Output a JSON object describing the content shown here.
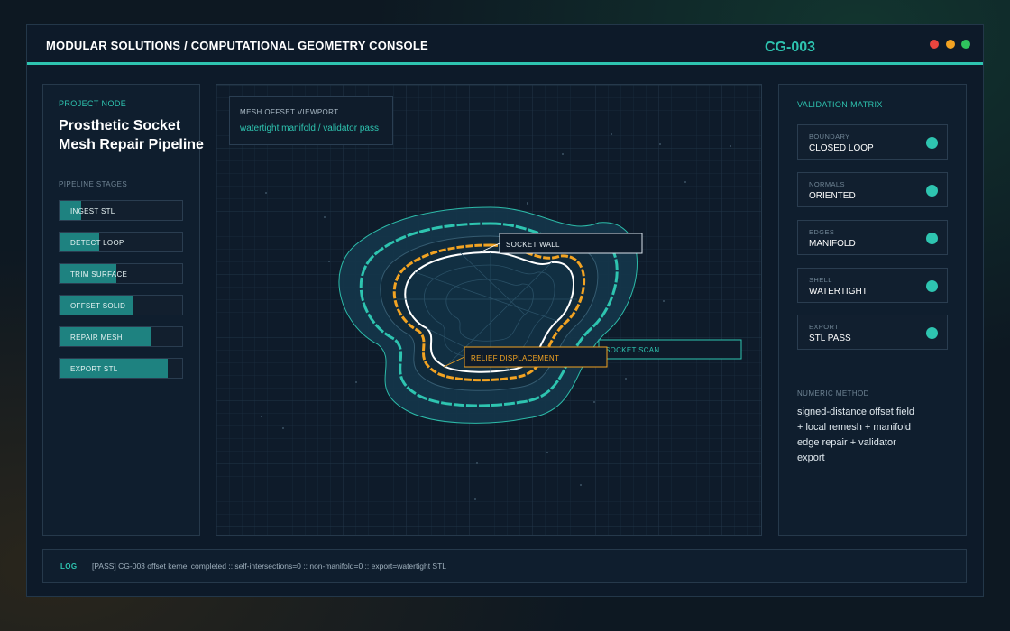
{
  "window": {
    "title": "MODULAR SOLUTIONS / COMPUTATIONAL GEOMETRY CONSOLE",
    "console_id": "CG-003",
    "controls": [
      "close",
      "minimize",
      "maximize"
    ]
  },
  "left_panel": {
    "section_label": "PROJECT NODE",
    "project_title_line1": "Prosthetic Socket",
    "project_title_line2": "Mesh Repair Pipeline",
    "stages_label": "PIPELINE STAGES",
    "stages": [
      {
        "label": "INGEST STL",
        "progress": 0.18
      },
      {
        "label": "DETECT LOOP",
        "progress": 0.32
      },
      {
        "label": "TRIM SURFACE",
        "progress": 0.46
      },
      {
        "label": "OFFSET SOLID",
        "progress": 0.6
      },
      {
        "label": "REPAIR MESH",
        "progress": 0.74
      },
      {
        "label": "EXPORT STL",
        "progress": 0.88
      }
    ]
  },
  "viewport": {
    "title": "MESH OFFSET VIEWPORT",
    "subtitle": "watertight manifold / validator pass",
    "callouts": {
      "socket_wall": "SOCKET WALL",
      "relief_displacement": "RELIEF DISPLACEMENT",
      "socket_scan": "SOCKET SCAN"
    }
  },
  "right_panel": {
    "section_label": "VALIDATION MATRIX",
    "checks": [
      {
        "key": "BOUNDARY",
        "value": "CLOSED LOOP"
      },
      {
        "key": "NORMALS",
        "value": "ORIENTED"
      },
      {
        "key": "EDGES",
        "value": "MANIFOLD"
      },
      {
        "key": "SHELL",
        "value": "WATERTIGHT"
      },
      {
        "key": "EXPORT",
        "value": "STL PASS"
      }
    ],
    "method_label": "NUMERIC METHOD",
    "method_lines": [
      "signed-distance offset field",
      "+ local remesh + manifold",
      "edge repair + validator",
      "export"
    ]
  },
  "log": {
    "label": "LOG",
    "text": "[PASS] CG-003 offset kernel completed :: self-intersections=0 :: non-manifold=0 :: export=watertight STL"
  },
  "colors": {
    "accent": "#2ec4b0",
    "relief": "#f2a322",
    "wall": "#ffffff",
    "stage_fill": "#1e8280"
  },
  "icons": {
    "status": "status-dot-icon",
    "close": "close-dot-icon",
    "minimize": "minimize-dot-icon",
    "maximize": "maximize-dot-icon"
  }
}
